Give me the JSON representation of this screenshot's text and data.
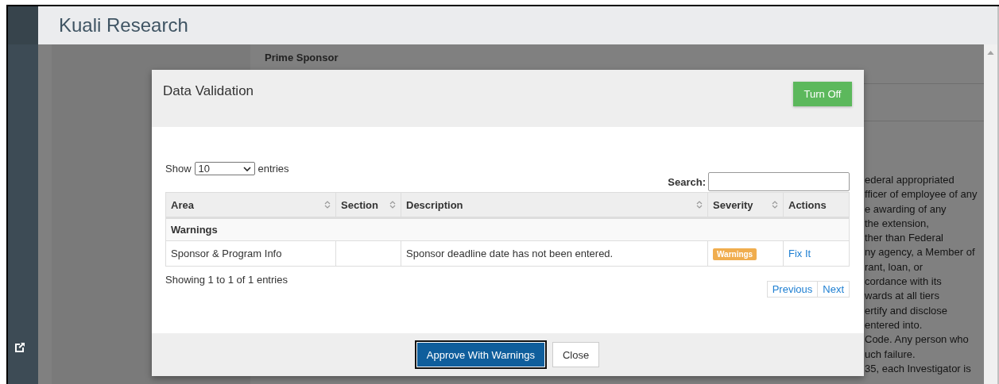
{
  "app": {
    "title": "Kuali Research"
  },
  "background": {
    "heading": "Prime Sponsor",
    "text_lines": [
      "ederal appropriated",
      "fficer of employee of any",
      "e awarding of any",
      "the extension,",
      "ther than Federal",
      "ny agency, a Member of",
      "rant, loan, or",
      "cordance with its",
      "wards at all tiers",
      "ertify and disclose",
      "entered into.",
      "Code. Any person who",
      "uch failure.",
      "35, each Investigator is"
    ]
  },
  "dialog": {
    "title": "Data Validation",
    "toggle_button": "Turn Off",
    "length_menu": {
      "prefix": "Show",
      "value": "10",
      "suffix": "entries"
    },
    "search": {
      "label": "Search:"
    },
    "table": {
      "columns": [
        {
          "label": "Area",
          "sortable": true
        },
        {
          "label": "Section",
          "sortable": true
        },
        {
          "label": "Description",
          "sortable": true
        },
        {
          "label": "Severity",
          "sortable": true
        },
        {
          "label": "Actions",
          "sortable": false
        }
      ],
      "groups": [
        {
          "label": "Warnings",
          "rows": [
            {
              "area": "Sponsor & Program Info",
              "description": "Sponsor deadline date has not been entered.",
              "severity": "Warnings",
              "action": "Fix It"
            }
          ]
        }
      ]
    },
    "info": "Showing 1 to 1 of 1 entries",
    "pagination": [
      "Previous",
      "Next"
    ],
    "buttons": [
      {
        "label": "Approve With Warnings",
        "kind": "primary"
      },
      {
        "label": "Close",
        "kind": "default"
      }
    ]
  }
}
